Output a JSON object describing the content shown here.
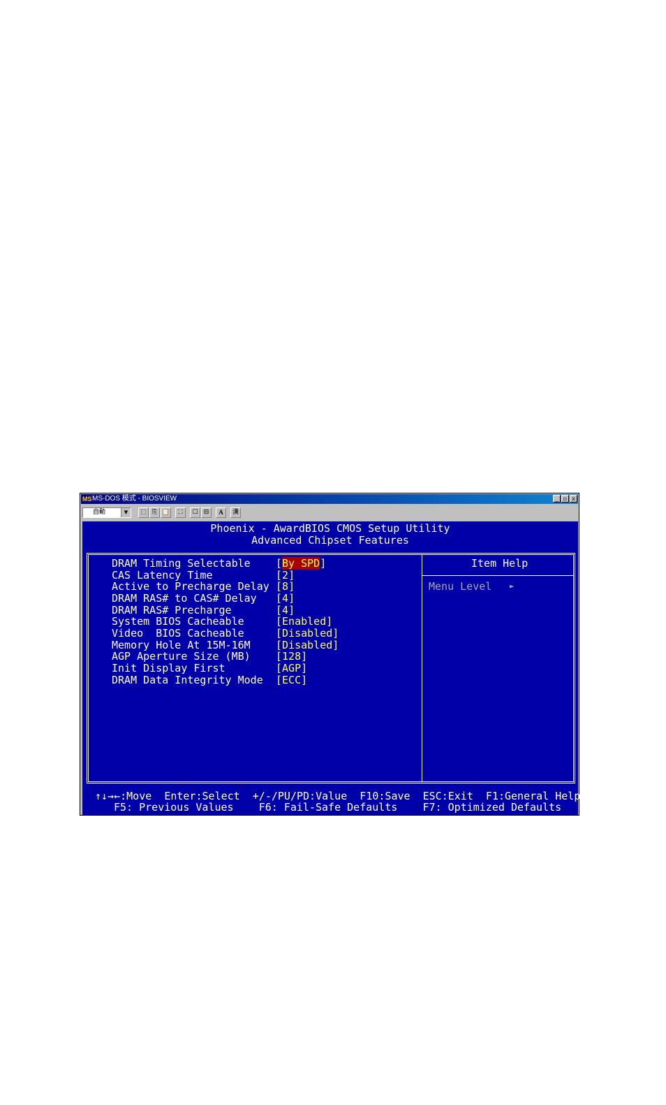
{
  "window": {
    "title": "MS-DOS 模式 - BIOSVIEW",
    "icon_glyph": "MS",
    "controls": [
      "_",
      "▫",
      "x"
    ]
  },
  "toolbar": {
    "font_select": "自動",
    "buttons": [
      "⬚",
      "⎘",
      "📋",
      "⛶",
      "☐",
      "⊟",
      "A",
      "漢"
    ]
  },
  "bios": {
    "title": "Phoenix - AwardBIOS CMOS Setup Utility",
    "subtitle": "Advanced Chipset Features",
    "items": [
      {
        "label": "DRAM Timing Selectable",
        "value": "By SPD",
        "selected": true
      },
      {
        "label": "CAS Latency Time",
        "value": "2"
      },
      {
        "label": "Active to Precharge Delay",
        "value": "8"
      },
      {
        "label": "DRAM RAS# to CAS# Delay",
        "value": "4"
      },
      {
        "label": "DRAM RAS# Precharge",
        "value": "4"
      },
      {
        "label": "System BIOS Cacheable",
        "value": "Enabled"
      },
      {
        "label": "Video  BIOS Cacheable",
        "value": "Disabled"
      },
      {
        "label": "Memory Hole At 15M-16M",
        "value": "Disabled"
      },
      {
        "label": "AGP Aperture Size (MB)",
        "value": "128"
      },
      {
        "label": "Init Display First",
        "value": "AGP"
      },
      {
        "label": "DRAM Data Integrity Mode",
        "value": "ECC"
      }
    ],
    "help_title": "Item Help",
    "menu_level": "Menu Level",
    "menu_level_arrow": "►",
    "footer_line1": "↑↓→←:Move  Enter:Select  +/-/PU/PD:Value  F10:Save  ESC:Exit  F1:General Help",
    "footer_line2": "F5: Previous Values    F6: Fail-Safe Defaults    F7: Optimized Defaults"
  },
  "colors": {
    "bios_background": "#0000a8",
    "value_text": "#ffff55",
    "selected_background": "#a80000",
    "help_dim_text": "#a8a8a8"
  }
}
